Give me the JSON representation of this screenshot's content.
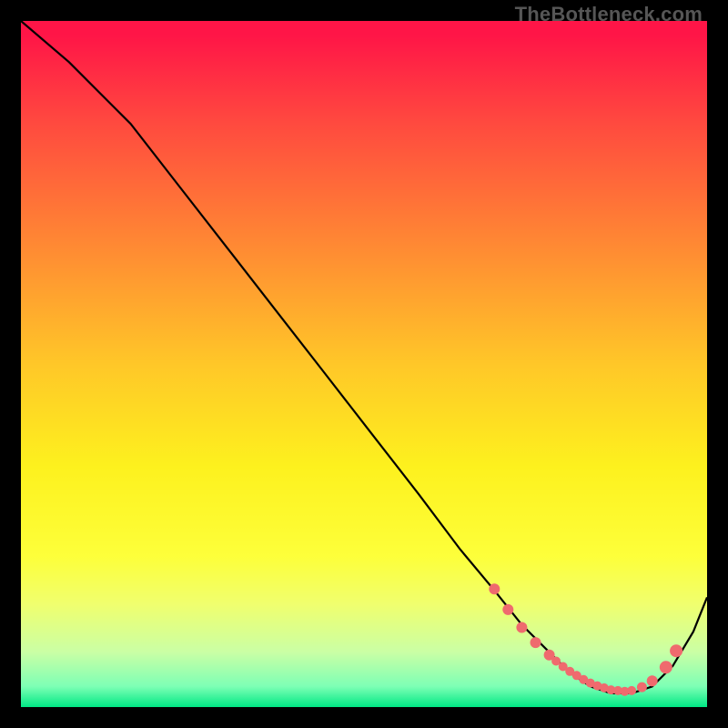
{
  "watermark": "TheBottleneck.com",
  "chart_data": {
    "type": "line",
    "title": "",
    "xlabel": "",
    "ylabel": "",
    "xlim": [
      0,
      100
    ],
    "ylim": [
      0,
      100
    ],
    "series": [
      {
        "name": "curve",
        "x": [
          0,
          7,
          11,
          16,
          23,
          30,
          37,
          44,
          51,
          58,
          64,
          69,
          73,
          77,
          80,
          83,
          86,
          89,
          92,
          95,
          98,
          100
        ],
        "y": [
          100,
          94,
          90,
          85,
          76,
          67,
          58,
          49,
          40,
          31,
          23,
          17,
          12,
          8,
          5,
          3,
          2,
          2,
          3,
          6,
          11,
          16
        ]
      }
    ],
    "highlight_dots": {
      "x": [
        69,
        71,
        73,
        75,
        77,
        78,
        79,
        80,
        81,
        82,
        83,
        84,
        85,
        86,
        87,
        88,
        89,
        90.5,
        92,
        94,
        95.5
      ],
      "y": [
        17.2,
        14.2,
        11.6,
        9.4,
        7.6,
        6.7,
        5.9,
        5.2,
        4.6,
        4.0,
        3.5,
        3.1,
        2.8,
        2.5,
        2.4,
        2.3,
        2.4,
        2.9,
        3.8,
        5.8,
        8.2
      ],
      "r": [
        6,
        6,
        6,
        6,
        6,
        5,
        5,
        5,
        5,
        5,
        5,
        5,
        5,
        5,
        5,
        5,
        5,
        5.5,
        6,
        7,
        7
      ]
    },
    "colors": {
      "curve": "#000000",
      "dots": "#ef6a6e"
    }
  }
}
